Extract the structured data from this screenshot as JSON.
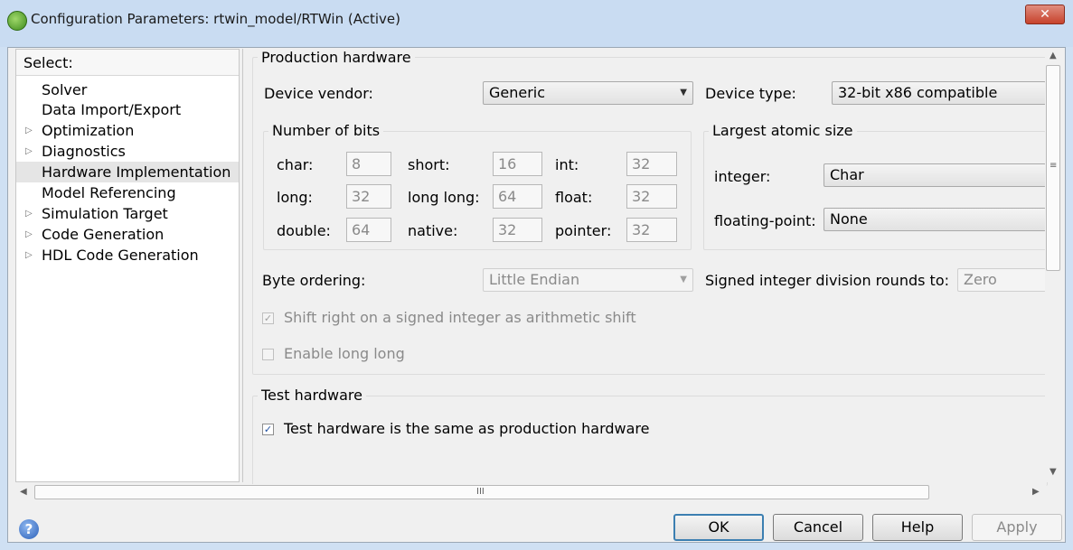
{
  "window": {
    "title": "Configuration Parameters: rtwin_model/RTWin (Active)",
    "close_glyph": "✕"
  },
  "tree": {
    "header": "Select:",
    "items": [
      {
        "label": "Solver",
        "expandable": false,
        "selected": false
      },
      {
        "label": "Data Import/Export",
        "expandable": false,
        "selected": false
      },
      {
        "label": "Optimization",
        "expandable": true,
        "selected": false
      },
      {
        "label": "Diagnostics",
        "expandable": true,
        "selected": false
      },
      {
        "label": "Hardware Implementation",
        "expandable": false,
        "selected": true
      },
      {
        "label": "Model Referencing",
        "expandable": false,
        "selected": false
      },
      {
        "label": "Simulation Target",
        "expandable": true,
        "selected": false
      },
      {
        "label": "Code Generation",
        "expandable": true,
        "selected": false
      },
      {
        "label": "HDL Code Generation",
        "expandable": true,
        "selected": false
      }
    ]
  },
  "production": {
    "legend": "Production hardware",
    "device_vendor_label": "Device vendor:",
    "device_vendor_value": "Generic",
    "device_type_label": "Device type:",
    "device_type_value": "32-bit x86 compatible",
    "bits": {
      "legend": "Number of bits",
      "char_label": "char:",
      "char_value": "8",
      "short_label": "short:",
      "short_value": "16",
      "int_label": "int:",
      "int_value": "32",
      "long_label": "long:",
      "long_value": "32",
      "longlong_label": "long long:",
      "longlong_value": "64",
      "float_label": "float:",
      "float_value": "32",
      "double_label": "double:",
      "double_value": "64",
      "native_label": "native:",
      "native_value": "32",
      "pointer_label": "pointer:",
      "pointer_value": "32"
    },
    "atomic": {
      "legend": "Largest atomic size",
      "integer_label": "integer:",
      "integer_value": "Char",
      "float_label": "floating-point:",
      "float_value": "None"
    },
    "byte_ordering_label": "Byte ordering:",
    "byte_ordering_value": "Little Endian",
    "signed_div_label": "Signed integer division rounds to:",
    "signed_div_value": "Zero",
    "shift_right_label": "Shift right on a signed integer as arithmetic shift",
    "shift_right_checked": true,
    "enable_long_long_label": "Enable long long",
    "enable_long_long_checked": false
  },
  "test": {
    "legend": "Test hardware",
    "same_label": "Test hardware is the same as production hardware",
    "same_checked": true
  },
  "scroll": {
    "hgrip": "III"
  },
  "buttons": {
    "ok": "OK",
    "cancel": "Cancel",
    "help": "Help",
    "apply": "Apply"
  },
  "colors": {
    "accent": "#3c7fb1",
    "title_bar": "#c9dcf2",
    "close": "#c7422c"
  }
}
